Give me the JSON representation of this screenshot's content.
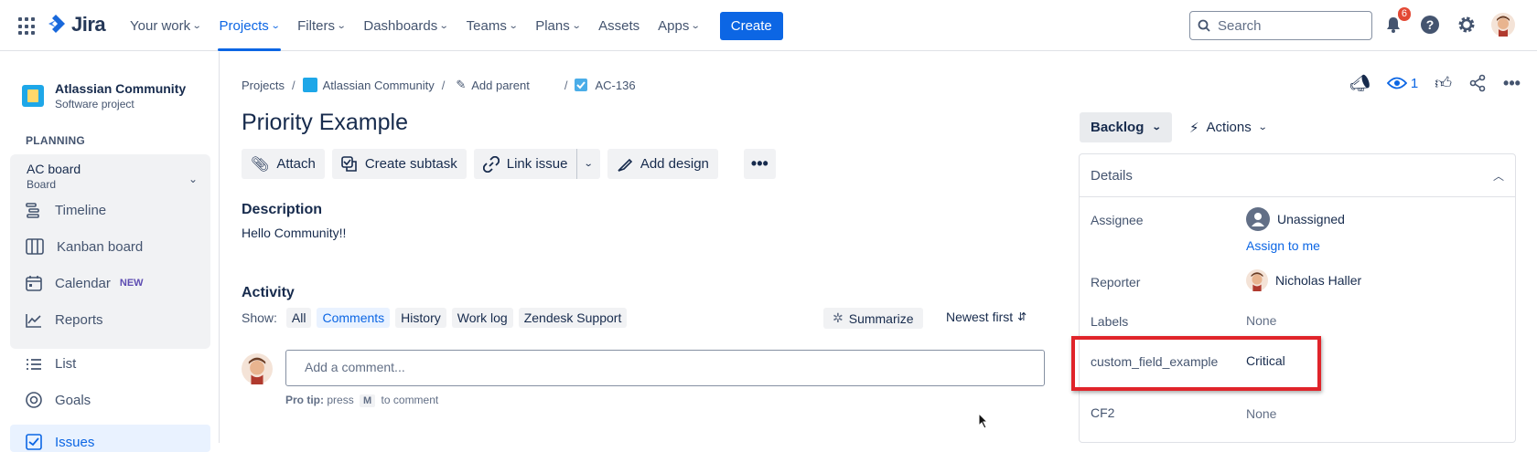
{
  "topnav": {
    "logo": "Jira",
    "items": [
      {
        "label": "Your work",
        "dropdown": true
      },
      {
        "label": "Projects",
        "dropdown": true,
        "active": true
      },
      {
        "label": "Filters",
        "dropdown": true
      },
      {
        "label": "Dashboards",
        "dropdown": true
      },
      {
        "label": "Teams",
        "dropdown": true
      },
      {
        "label": "Plans",
        "dropdown": true
      },
      {
        "label": "Assets",
        "dropdown": false
      },
      {
        "label": "Apps",
        "dropdown": true
      }
    ],
    "create_label": "Create",
    "search_placeholder": "Search",
    "notifications_count": "6"
  },
  "sidebar": {
    "project_name": "Atlassian Community",
    "project_type": "Software project",
    "section_label": "PLANNING",
    "board_title": "AC board",
    "board_subtitle": "Board",
    "items": [
      {
        "label": "Timeline",
        "icon": "timeline-icon"
      },
      {
        "label": "Kanban board",
        "icon": "kanban-icon"
      },
      {
        "label": "Calendar",
        "icon": "calendar-icon",
        "tag": "NEW"
      },
      {
        "label": "Reports",
        "icon": "reports-icon"
      },
      {
        "label": "List",
        "icon": "list-icon"
      },
      {
        "label": "Goals",
        "icon": "goals-icon"
      },
      {
        "label": "Issues",
        "icon": "issues-icon"
      }
    ]
  },
  "breadcrumb": {
    "projects": "Projects",
    "project": "Atlassian Community",
    "add_parent": "Add parent",
    "issue_key": "AC-136"
  },
  "issue": {
    "title": "Priority Example",
    "toolbar": {
      "attach": "Attach",
      "create_subtask": "Create subtask",
      "link_issue": "Link issue",
      "add_design": "Add design"
    },
    "description_heading": "Description",
    "description_text": "Hello Community!!"
  },
  "activity": {
    "heading": "Activity",
    "show_label": "Show:",
    "filters": [
      "All",
      "Comments",
      "History",
      "Work log",
      "Zendesk Support"
    ],
    "selected_filter": "Comments",
    "summarize": "Summarize",
    "sort": "Newest first",
    "comment_placeholder": "Add a comment...",
    "protip_prefix": "Pro tip:",
    "protip_press": "press",
    "protip_key": "M",
    "protip_suffix": "to comment"
  },
  "right_panel": {
    "watch_count": "1",
    "status": "Backlog",
    "actions": "Actions",
    "details_heading": "Details",
    "fields": {
      "assignee_label": "Assignee",
      "assignee_value": "Unassigned",
      "assign_to_me": "Assign to me",
      "reporter_label": "Reporter",
      "reporter_value": "Nicholas Haller",
      "labels_label": "Labels",
      "labels_value": "None",
      "custom_label": "custom_field_example",
      "custom_value": "Critical",
      "cf2_label": "CF2",
      "cf2_value": "None"
    }
  },
  "colors": {
    "accent": "#0c66e4",
    "highlight": "#e0242a"
  }
}
